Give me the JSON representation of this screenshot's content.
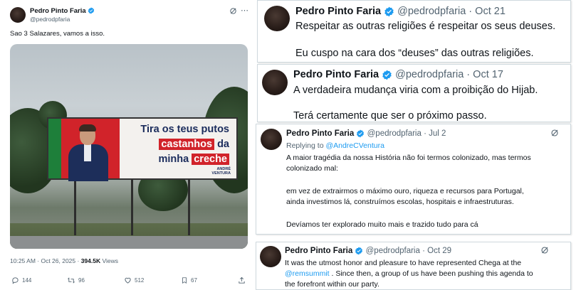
{
  "author": {
    "name": "Pedro Pinto Faria",
    "handle": "@pedrodpfaria"
  },
  "colors": {
    "verified": "#1d9bf0",
    "link": "#1d9bf0",
    "muted": "#536471",
    "billboard_red": "#d1232a",
    "billboard_navy": "#1b2c5c",
    "billboard_green": "#1e7f3a"
  },
  "left_tweet": {
    "name": "Pedro Pinto Faria",
    "handle": "@pedrodpfaria",
    "text": "Sao 3 Salazares, vamos a isso.",
    "billboard": {
      "line1": "Tira os teus putos",
      "line2a": "castanhos",
      "line2b": " da",
      "line3a": "minha ",
      "line3b": "creche",
      "brand1": "ANDRÉ",
      "brand2": "VENTURA"
    },
    "time": "10:25 AM · Oct 26, 2025 · ",
    "views_count": "394.5K",
    "views_label": " Views",
    "actions": {
      "replies": "144",
      "reposts": "96",
      "likes": "512",
      "bookmarks": "67"
    },
    "icons": [
      "grok-icon",
      "more-icon",
      "reply-icon",
      "repost-icon",
      "like-icon",
      "bookmark-icon",
      "share-icon"
    ]
  },
  "tweet_r1": {
    "name": "Pedro Pinto Faria",
    "handle": "@pedrodpfaria",
    "date": "Oct 21",
    "line1": "Respeitar as outras religiões é respeitar os seus deuses.",
    "line2": "Eu cuspo na cara dos “deuses” das outras religiões."
  },
  "tweet_r2": {
    "name": "Pedro Pinto Faria",
    "handle": "@pedrodpfaria",
    "date": "Oct 17",
    "line1": "A verdadeira mudança viria com a proibição do Hijab.",
    "line2": "Terá certamente que ser o próximo passo."
  },
  "tweet_r3": {
    "name": "Pedro Pinto Faria",
    "handle": "@pedrodpfaria",
    "date": "Jul 2",
    "replying_label": "Replying to ",
    "replying_to": "@AndreCVentura",
    "p1a": "A maior tragédia da nossa História não foi termos colonizado, mas termos",
    "p1b": "colonizado mal:",
    "p2a": "em vez de extrairmos o máximo ouro, riqueza e recursos para Portugal,",
    "p2b": "ainda investimos lá, construímos escolas, hospitais e infraestruturas.",
    "p3": "Devíamos ter explorado muito mais e trazido tudo para cá"
  },
  "tweet_r4": {
    "name": "Pedro Pinto Faria",
    "handle": "@pedrodpfaria",
    "date": "Oct 29",
    "l1": "It was the utmost honor and pleasure to have represented Chega at the",
    "mention": "@remsummit",
    "l2": " . Since then, a group of us have been pushing this agenda to",
    "l3": "the forefront within our party."
  }
}
